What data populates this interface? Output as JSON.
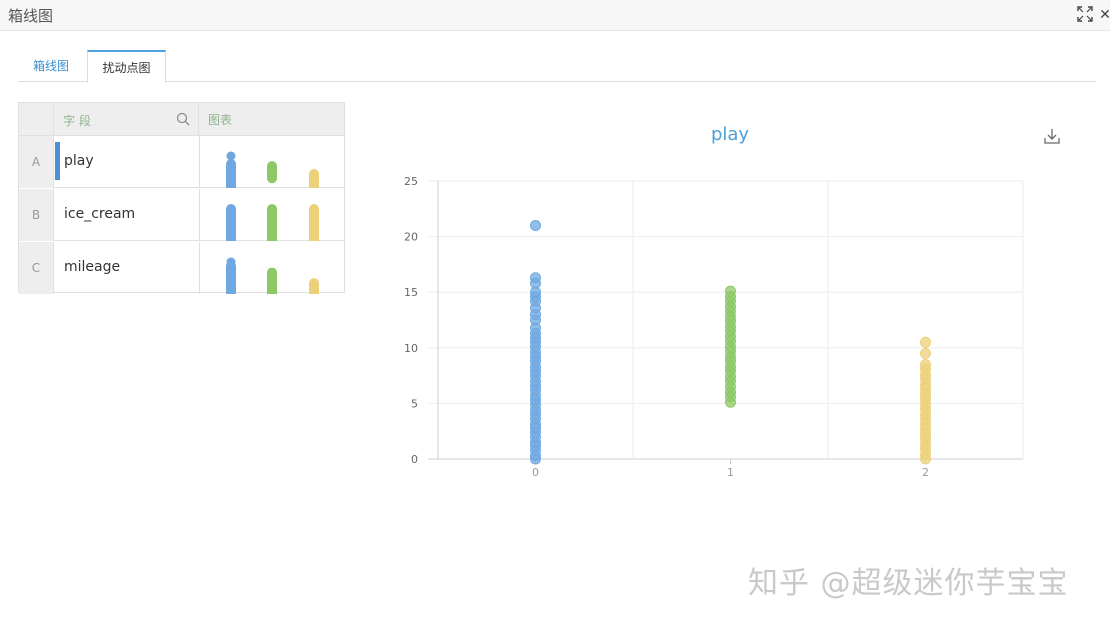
{
  "window": {
    "title": "箱线图",
    "icons": {
      "maximize": "expand-icon",
      "close": "close-icon"
    }
  },
  "tabs": [
    {
      "label": "箱线图",
      "active": false
    },
    {
      "label": "扰动点图",
      "active": true
    }
  ],
  "field_table": {
    "header": {
      "field": "字段",
      "chart": "图表"
    },
    "rows": [
      {
        "index": "A",
        "name": "play",
        "selected": true
      },
      {
        "index": "B",
        "name": "ice_cream",
        "selected": false
      },
      {
        "index": "C",
        "name": "mileage",
        "selected": false
      }
    ]
  },
  "chart": {
    "title": "play"
  },
  "chart_data": {
    "type": "scatter",
    "title": "play",
    "xlabel": "",
    "ylabel": "",
    "categories": [
      "0",
      "1",
      "2"
    ],
    "ylim": [
      0,
      25
    ],
    "yticks": [
      0,
      5,
      10,
      15,
      20,
      25
    ],
    "grid": true,
    "series": [
      {
        "category": "0",
        "color": "#6fa8e0",
        "values": [
          0,
          0.3,
          0.8,
          1.2,
          1.5,
          2.0,
          2.4,
          2.8,
          3.1,
          3.6,
          4.0,
          4.4,
          4.9,
          5.3,
          5.7,
          6.2,
          6.6,
          7.0,
          7.5,
          7.9,
          8.3,
          8.8,
          9.2,
          9.6,
          10.1,
          10.5,
          10.9,
          11.3,
          11.8,
          12.5,
          13.0,
          13.6,
          14.2,
          14.6,
          15.0,
          15.8,
          16.3,
          21.0
        ]
      },
      {
        "category": "1",
        "color": "#8cc865",
        "values": [
          5.1,
          5.6,
          6.0,
          6.5,
          7.0,
          7.4,
          7.9,
          8.3,
          8.8,
          9.2,
          9.7,
          10.1,
          10.6,
          11.0,
          11.5,
          11.9,
          12.4,
          12.8,
          13.3,
          13.7,
          14.2,
          14.6,
          15.1
        ]
      },
      {
        "category": "2",
        "color": "#ecd07a",
        "values": [
          0,
          0.4,
          0.9,
          1.3,
          1.8,
          2.2,
          2.7,
          3.1,
          3.6,
          4.0,
          4.5,
          4.9,
          5.4,
          5.8,
          6.3,
          6.7,
          7.2,
          7.6,
          8.1,
          8.5,
          9.5,
          10.5
        ]
      }
    ]
  },
  "mini_charts": [
    {
      "field": "play",
      "strips": [
        {
          "color": "#6fa8e0",
          "min": 0,
          "max": 16.3,
          "outlier": 21.0
        },
        {
          "color": "#8cc865",
          "min": 5.1,
          "max": 15.1
        },
        {
          "color": "#ecd07a",
          "min": 0,
          "max": 10.5
        }
      ]
    },
    {
      "field": "ice_cream",
      "strips": [
        {
          "color": "#6fa8e0",
          "min": 0,
          "max": 1
        },
        {
          "color": "#8cc865",
          "min": 0,
          "max": 1
        },
        {
          "color": "#ecd07a",
          "min": 0,
          "max": 1
        }
      ]
    },
    {
      "field": "mileage",
      "strips": [
        {
          "color": "#6fa8e0",
          "min": 0,
          "max": 0.75,
          "outlier": 0.85
        },
        {
          "color": "#8cc865",
          "min": 0,
          "max": 0.6
        },
        {
          "color": "#ecd07a",
          "min": 0,
          "max": 0.35
        }
      ]
    }
  ],
  "watermark": "知乎 @超级迷你芋宝宝"
}
